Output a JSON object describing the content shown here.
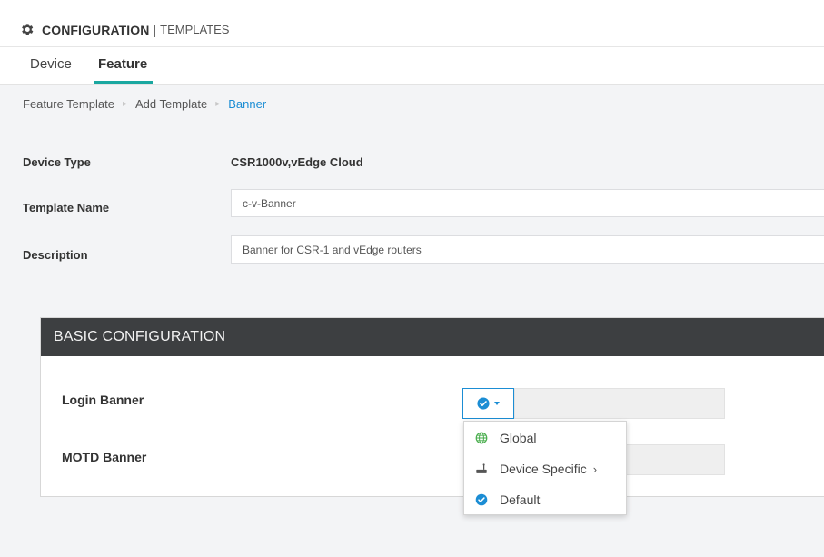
{
  "header": {
    "title": "CONFIGURATION",
    "separator": "|",
    "subtitle": "TEMPLATES",
    "icon": "gear-icon"
  },
  "tabs": [
    {
      "label": "Device",
      "active": false
    },
    {
      "label": "Feature",
      "active": true
    }
  ],
  "breadcrumb": {
    "items": [
      "Feature Template",
      "Add Template"
    ],
    "current": "Banner"
  },
  "form": {
    "device_type_label": "Device Type",
    "device_type_value": "CSR1000v,vEdge Cloud",
    "template_name_label": "Template Name",
    "template_name_value": "c-v-Banner",
    "description_label": "Description",
    "description_value": "Banner for CSR-1 and vEdge routers"
  },
  "basic_config": {
    "heading": "BASIC CONFIGURATION",
    "login_banner_label": "Login Banner",
    "motd_banner_label": "MOTD Banner",
    "selected_scope_icon": "check-circle-icon"
  },
  "scope_menu": {
    "items": [
      {
        "label": "Global",
        "icon": "globe-icon"
      },
      {
        "label": "Device Specific",
        "icon": "device-icon",
        "has_submenu": true
      },
      {
        "label": "Default",
        "icon": "check-circle-icon"
      }
    ]
  },
  "colors": {
    "accent": "#1b8dd4",
    "tab_underline": "#1aa7a0",
    "panel_header": "#3d3f41",
    "globe": "#4caf50"
  }
}
